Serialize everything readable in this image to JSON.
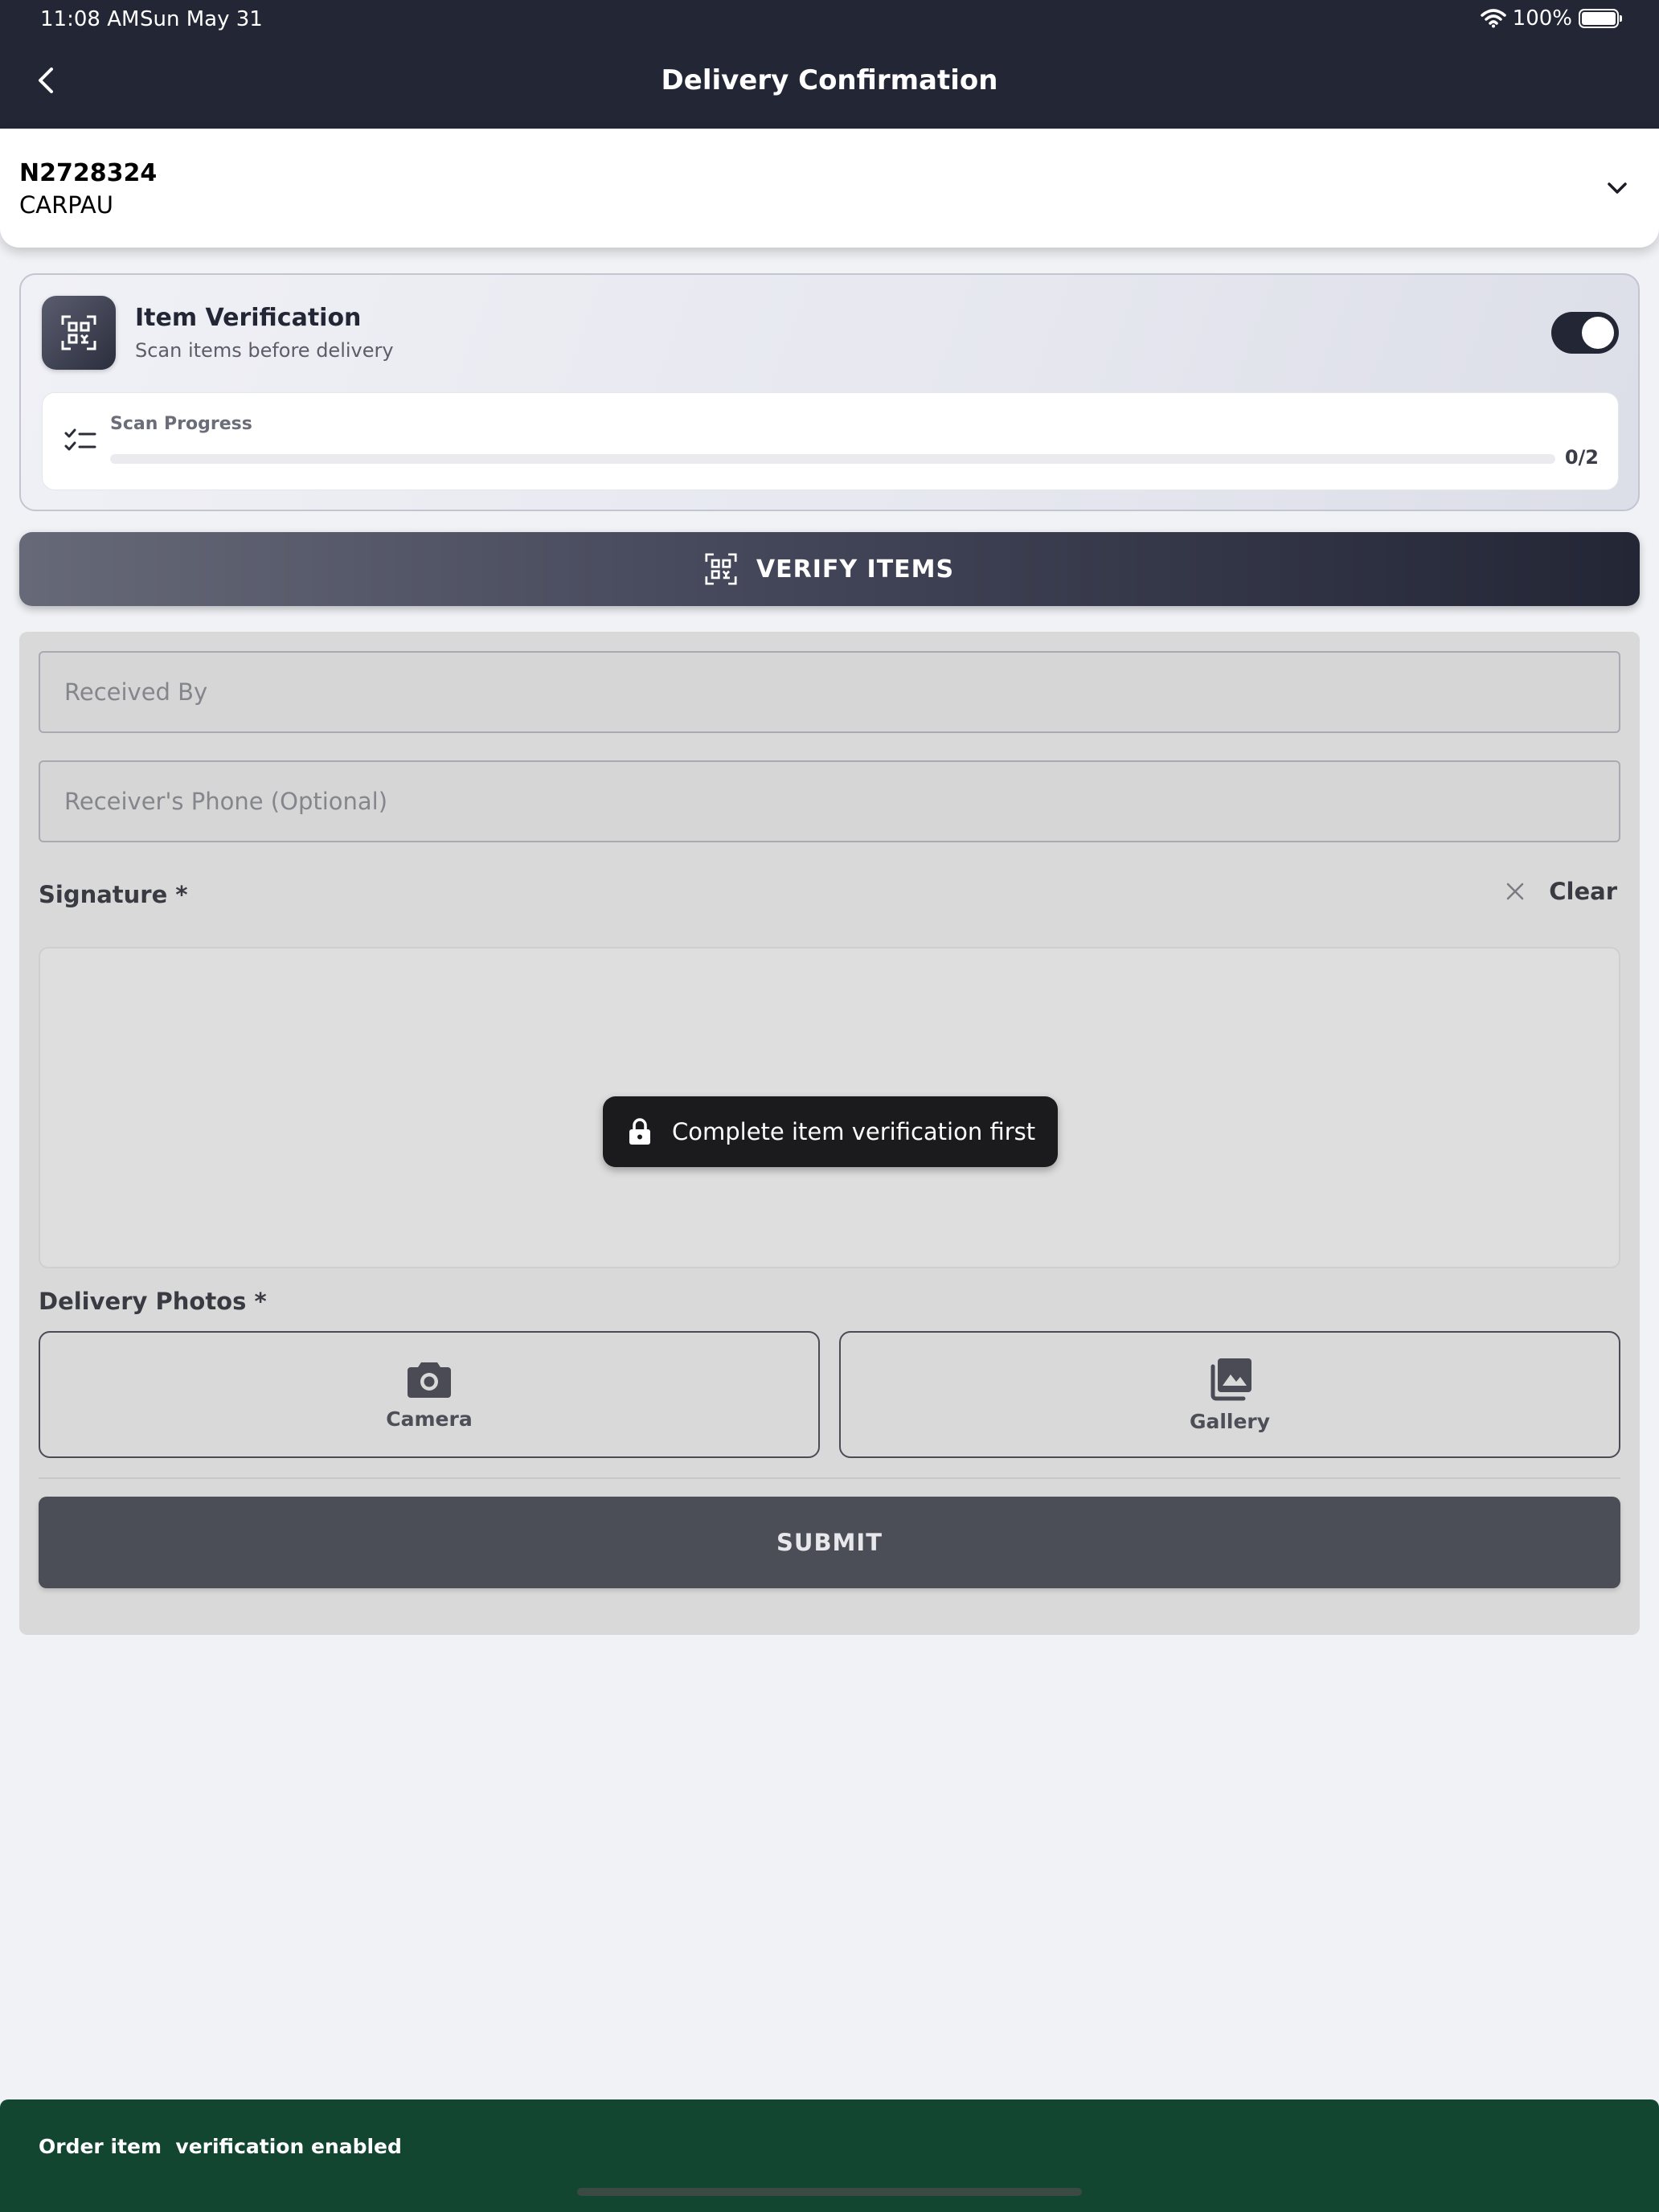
{
  "status_bar": {
    "time": "11:08 AM",
    "date": "Sun May 31",
    "battery": "100%"
  },
  "header": {
    "title": "Delivery Confirmation"
  },
  "order": {
    "id": "N2728324",
    "name": "CARPAU"
  },
  "item_verification": {
    "title": "Item Verification",
    "subtitle": "Scan items before delivery",
    "enabled": true,
    "progress_label": "Scan Progress",
    "progress_count": "0/2",
    "progress_fraction": 0
  },
  "verify_button": {
    "label": "VERIFY ITEMS"
  },
  "form": {
    "received_by_placeholder": "Received By",
    "phone_placeholder": "Receiver's Phone (Optional)",
    "signature_label": "Signature *",
    "clear_label": "Clear",
    "lock_message": "Complete item verification first",
    "photos_label": "Delivery Photos *",
    "camera_label": "Camera",
    "gallery_label": "Gallery",
    "submit_label": "SUBMIT"
  },
  "snackbar": {
    "message": "Order item  verification enabled"
  },
  "colors": {
    "header": "#232635",
    "snackbar": "#124630",
    "submit": "#4b4d57"
  },
  "icons": [
    "back-icon",
    "wifi-icon",
    "battery-icon",
    "chevron-down-icon",
    "qr-scan-icon",
    "checklist-icon",
    "close-icon",
    "lock-icon",
    "camera-icon",
    "gallery-icon"
  ]
}
